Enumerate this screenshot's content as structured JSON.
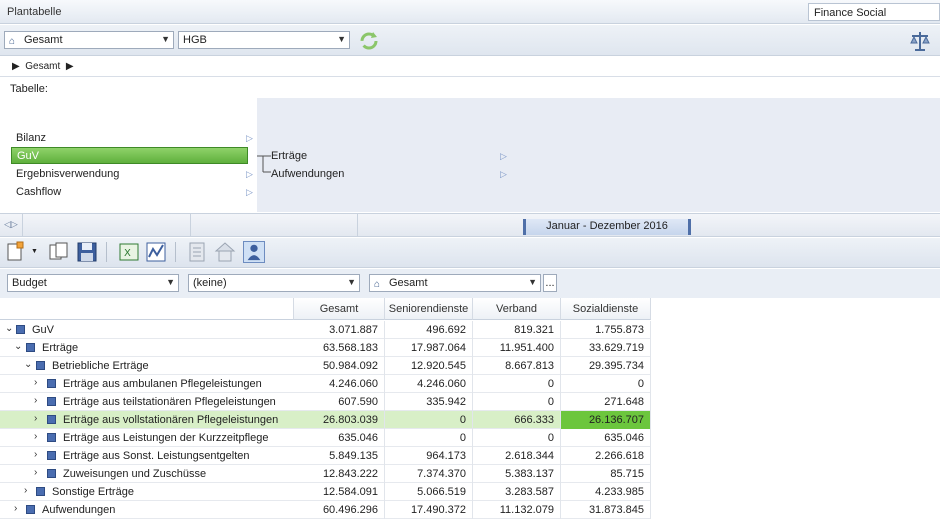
{
  "titlebar": {
    "title": "Plantabelle",
    "company": "Finance Social"
  },
  "toolbar1": {
    "scope": "Gesamt",
    "standard": "HGB"
  },
  "breadcrumb": {
    "item": "Gesamt"
  },
  "tabelle_label": "Tabelle:",
  "nav": {
    "left_items": [
      "Bilanz",
      "GuV",
      "Ergebnisverwendung",
      "Cashflow"
    ],
    "right_items": [
      "Erträge",
      "Aufwendungen"
    ]
  },
  "period": "Januar - Dezember 2016",
  "filters": {
    "type": "Budget",
    "second": "(keine)",
    "scope": "Gesamt",
    "more": "..."
  },
  "grid": {
    "columns": [
      "Gesamt",
      "Seniorendienste",
      "Verband",
      "Sozialdienste"
    ],
    "rows": [
      {
        "label": "GuV",
        "values": [
          "3.071.887",
          "496.692",
          "819.321",
          "1.755.873"
        ]
      },
      {
        "label": "Erträge",
        "values": [
          "63.568.183",
          "17.987.064",
          "11.951.400",
          "33.629.719"
        ]
      },
      {
        "label": "Betriebliche Erträge",
        "values": [
          "50.984.092",
          "12.920.545",
          "8.667.813",
          "29.395.734"
        ]
      },
      {
        "label": "Erträge aus ambulanen Pflegeleistungen",
        "values": [
          "4.246.060",
          "4.246.060",
          "0",
          "0"
        ]
      },
      {
        "label": "Erträge aus teilstationären Pflegeleistungen",
        "values": [
          "607.590",
          "335.942",
          "0",
          "271.648"
        ]
      },
      {
        "label": "Erträge aus vollstationären Pflegeleistungen",
        "values": [
          "26.803.039",
          "0",
          "666.333",
          "26.136.707"
        ]
      },
      {
        "label": "Erträge aus Leistungen der Kurzzeitpflege",
        "values": [
          "635.046",
          "0",
          "0",
          "635.046"
        ]
      },
      {
        "label": "Erträge aus Sonst. Leistungsentgelten",
        "values": [
          "5.849.135",
          "964.173",
          "2.618.344",
          "2.266.618"
        ]
      },
      {
        "label": "Zuweisungen und Zuschüsse",
        "values": [
          "12.843.222",
          "7.374.370",
          "5.383.137",
          "85.715"
        ]
      },
      {
        "label": "Sonstige Erträge",
        "values": [
          "12.584.091",
          "5.066.519",
          "3.283.587",
          "4.233.985"
        ]
      },
      {
        "label": "Aufwendungen",
        "values": [
          "60.496.296",
          "17.490.372",
          "11.132.079",
          "31.873.845"
        ]
      }
    ]
  },
  "colors": {
    "selection_green": "#6cc63d",
    "row_highlight": "#d8efc7",
    "tree_square": "#4a6db0"
  }
}
